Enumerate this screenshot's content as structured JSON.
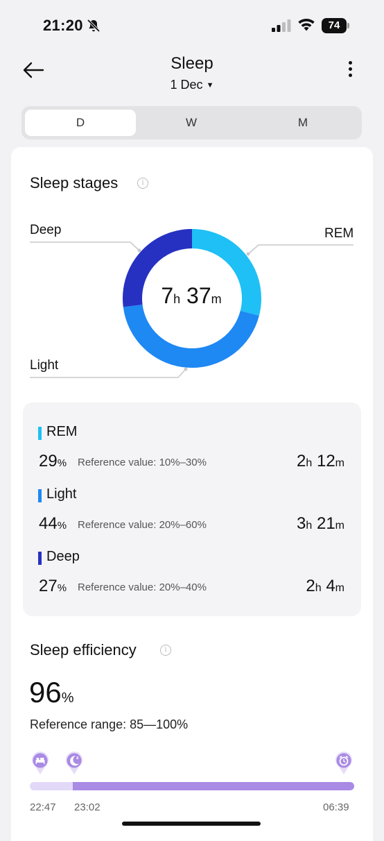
{
  "status": {
    "time": "21:20",
    "battery": "74"
  },
  "header": {
    "title": "Sleep",
    "date": "1 Dec"
  },
  "tabs": [
    {
      "label": "D"
    },
    {
      "label": "W"
    },
    {
      "label": "M"
    }
  ],
  "sleep_stages": {
    "title": "Sleep stages",
    "total_hours": "7",
    "total_minutes": "37",
    "unit_h": "h",
    "unit_m": "m",
    "chart_labels": {
      "deep": "Deep",
      "rem": "REM",
      "light": "Light"
    },
    "colors": {
      "rem": "#1ec0f5",
      "light": "#1e88f3",
      "deep": "#2631c2"
    },
    "stages": [
      {
        "name": "REM",
        "percent": "29",
        "reference": "Reference value: 10%–30%",
        "hours": "2",
        "minutes": "12"
      },
      {
        "name": "Light",
        "percent": "44",
        "reference": "Reference value: 20%–60%",
        "hours": "3",
        "minutes": "21"
      },
      {
        "name": "Deep",
        "percent": "27",
        "reference": "Reference value: 20%–40%",
        "hours": "2",
        "minutes": "4"
      }
    ],
    "pct_unit": "%"
  },
  "sleep_efficiency": {
    "title": "Sleep efficiency",
    "value": "96",
    "unit": "%",
    "reference": "Reference range: 85—100%",
    "times": {
      "bed": "22:47",
      "asleep": "23:02",
      "wake": "06:39"
    },
    "icons": {
      "bed": "bed-icon",
      "asleep": "moon-icon",
      "wake": "alarm-icon"
    }
  }
}
